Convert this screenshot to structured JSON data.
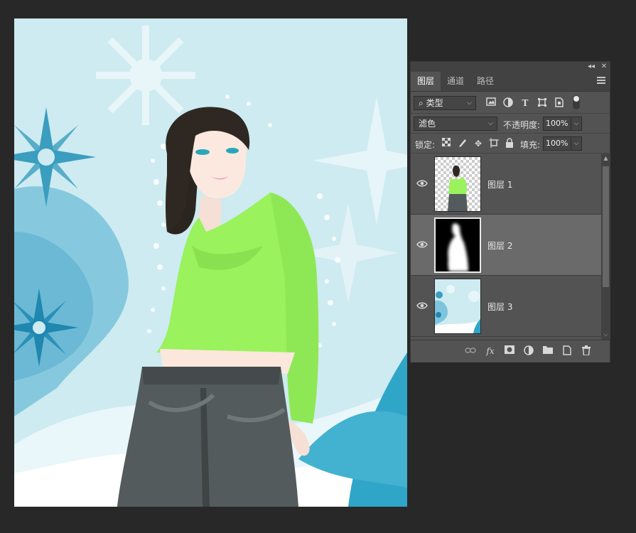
{
  "panel": {
    "tabs": [
      {
        "label": "图层",
        "active": true
      },
      {
        "label": "通道",
        "active": false
      },
      {
        "label": "路径",
        "active": false
      }
    ],
    "filter": {
      "label": "类型",
      "prefix_icon": "search-icon"
    },
    "blend_mode": "滤色",
    "opacity_label": "不透明度:",
    "opacity_value": "100%",
    "lock_label": "锁定:",
    "fill_label": "填充:",
    "fill_value": "100%",
    "layers": [
      {
        "name": "图层 1",
        "visible": true,
        "selected": false,
        "thumb": "woman-on-transparent"
      },
      {
        "name": "图层 2",
        "visible": true,
        "selected": true,
        "thumb": "white-silhouette-on-black"
      },
      {
        "name": "图层 3",
        "visible": true,
        "selected": false,
        "thumb": "snowflake-background"
      }
    ],
    "bottom_icons": [
      "link-icon",
      "fx-icon",
      "mask-icon",
      "adjustment-icon",
      "folder-icon",
      "new-layer-icon",
      "trash-icon"
    ]
  },
  "colors": {
    "workspace": "#282828",
    "panel": "#535353",
    "selected_layer": "#6a6a6a",
    "shirt": "#9af25c",
    "canvas_sky": "#cdebf1"
  }
}
